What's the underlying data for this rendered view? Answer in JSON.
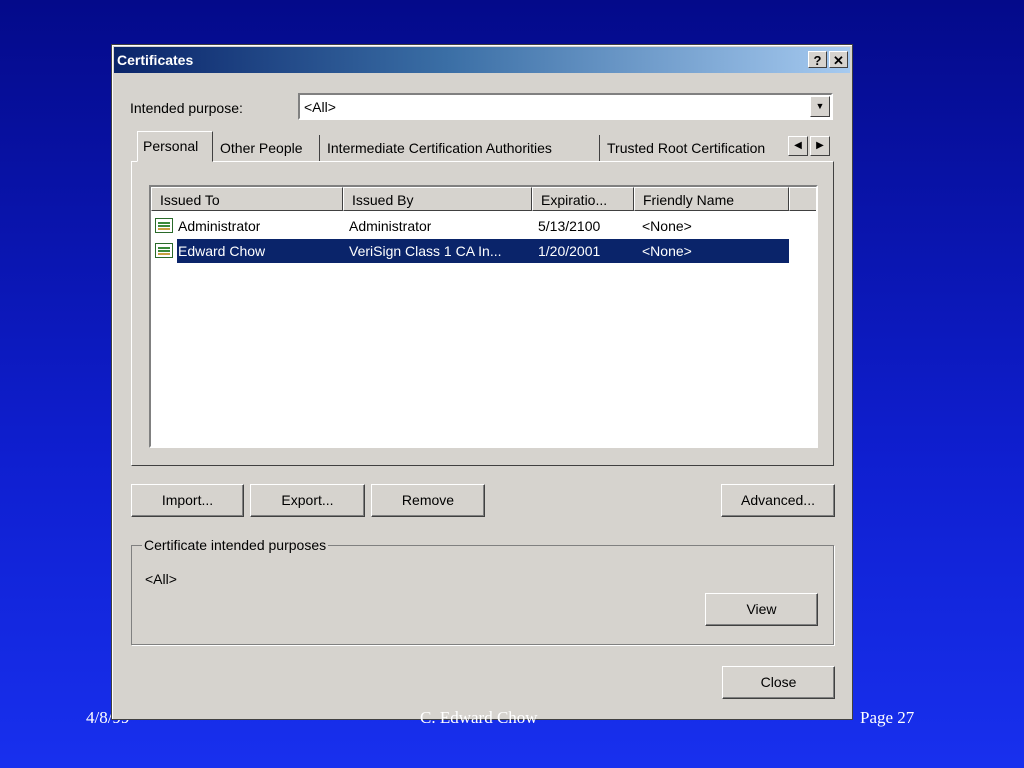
{
  "footer": {
    "date": "4/8/99",
    "author": "C. Edward Chow",
    "page": "Page  27"
  },
  "dialog": {
    "title": "Certificates",
    "help_btn": "?",
    "close_btn": "✕",
    "intended_purpose_label": "Intended purpose:",
    "intended_purpose_value": "<All>",
    "tabs": [
      {
        "label": "Personal",
        "active": true
      },
      {
        "label": "Other People",
        "active": false
      },
      {
        "label": "Intermediate Certification Authorities",
        "active": false
      },
      {
        "label": "Trusted Root Certification",
        "active": false
      }
    ],
    "columns": [
      "Issued To",
      "Issued By",
      "Expiratio...",
      "Friendly Name"
    ],
    "rows": [
      {
        "issued_to": "Administrator",
        "issued_by": "Administrator",
        "expiration": "5/13/2100",
        "friendly_name": "<None>",
        "selected": false
      },
      {
        "issued_to": "Edward Chow",
        "issued_by": "VeriSign Class 1 CA In...",
        "expiration": "1/20/2001",
        "friendly_name": "<None>",
        "selected": true
      }
    ],
    "buttons": {
      "import": "Import...",
      "export": "Export...",
      "remove": "Remove",
      "advanced": "Advanced...",
      "view": "View",
      "close": "Close"
    },
    "purposes_group_label": "Certificate intended purposes",
    "purposes_value": "<All>"
  },
  "colors": {
    "background": "#0f1fd0",
    "titlebar": "#0a246a",
    "selection": "#0a246a",
    "dialog_face": "#d6d3ce"
  }
}
